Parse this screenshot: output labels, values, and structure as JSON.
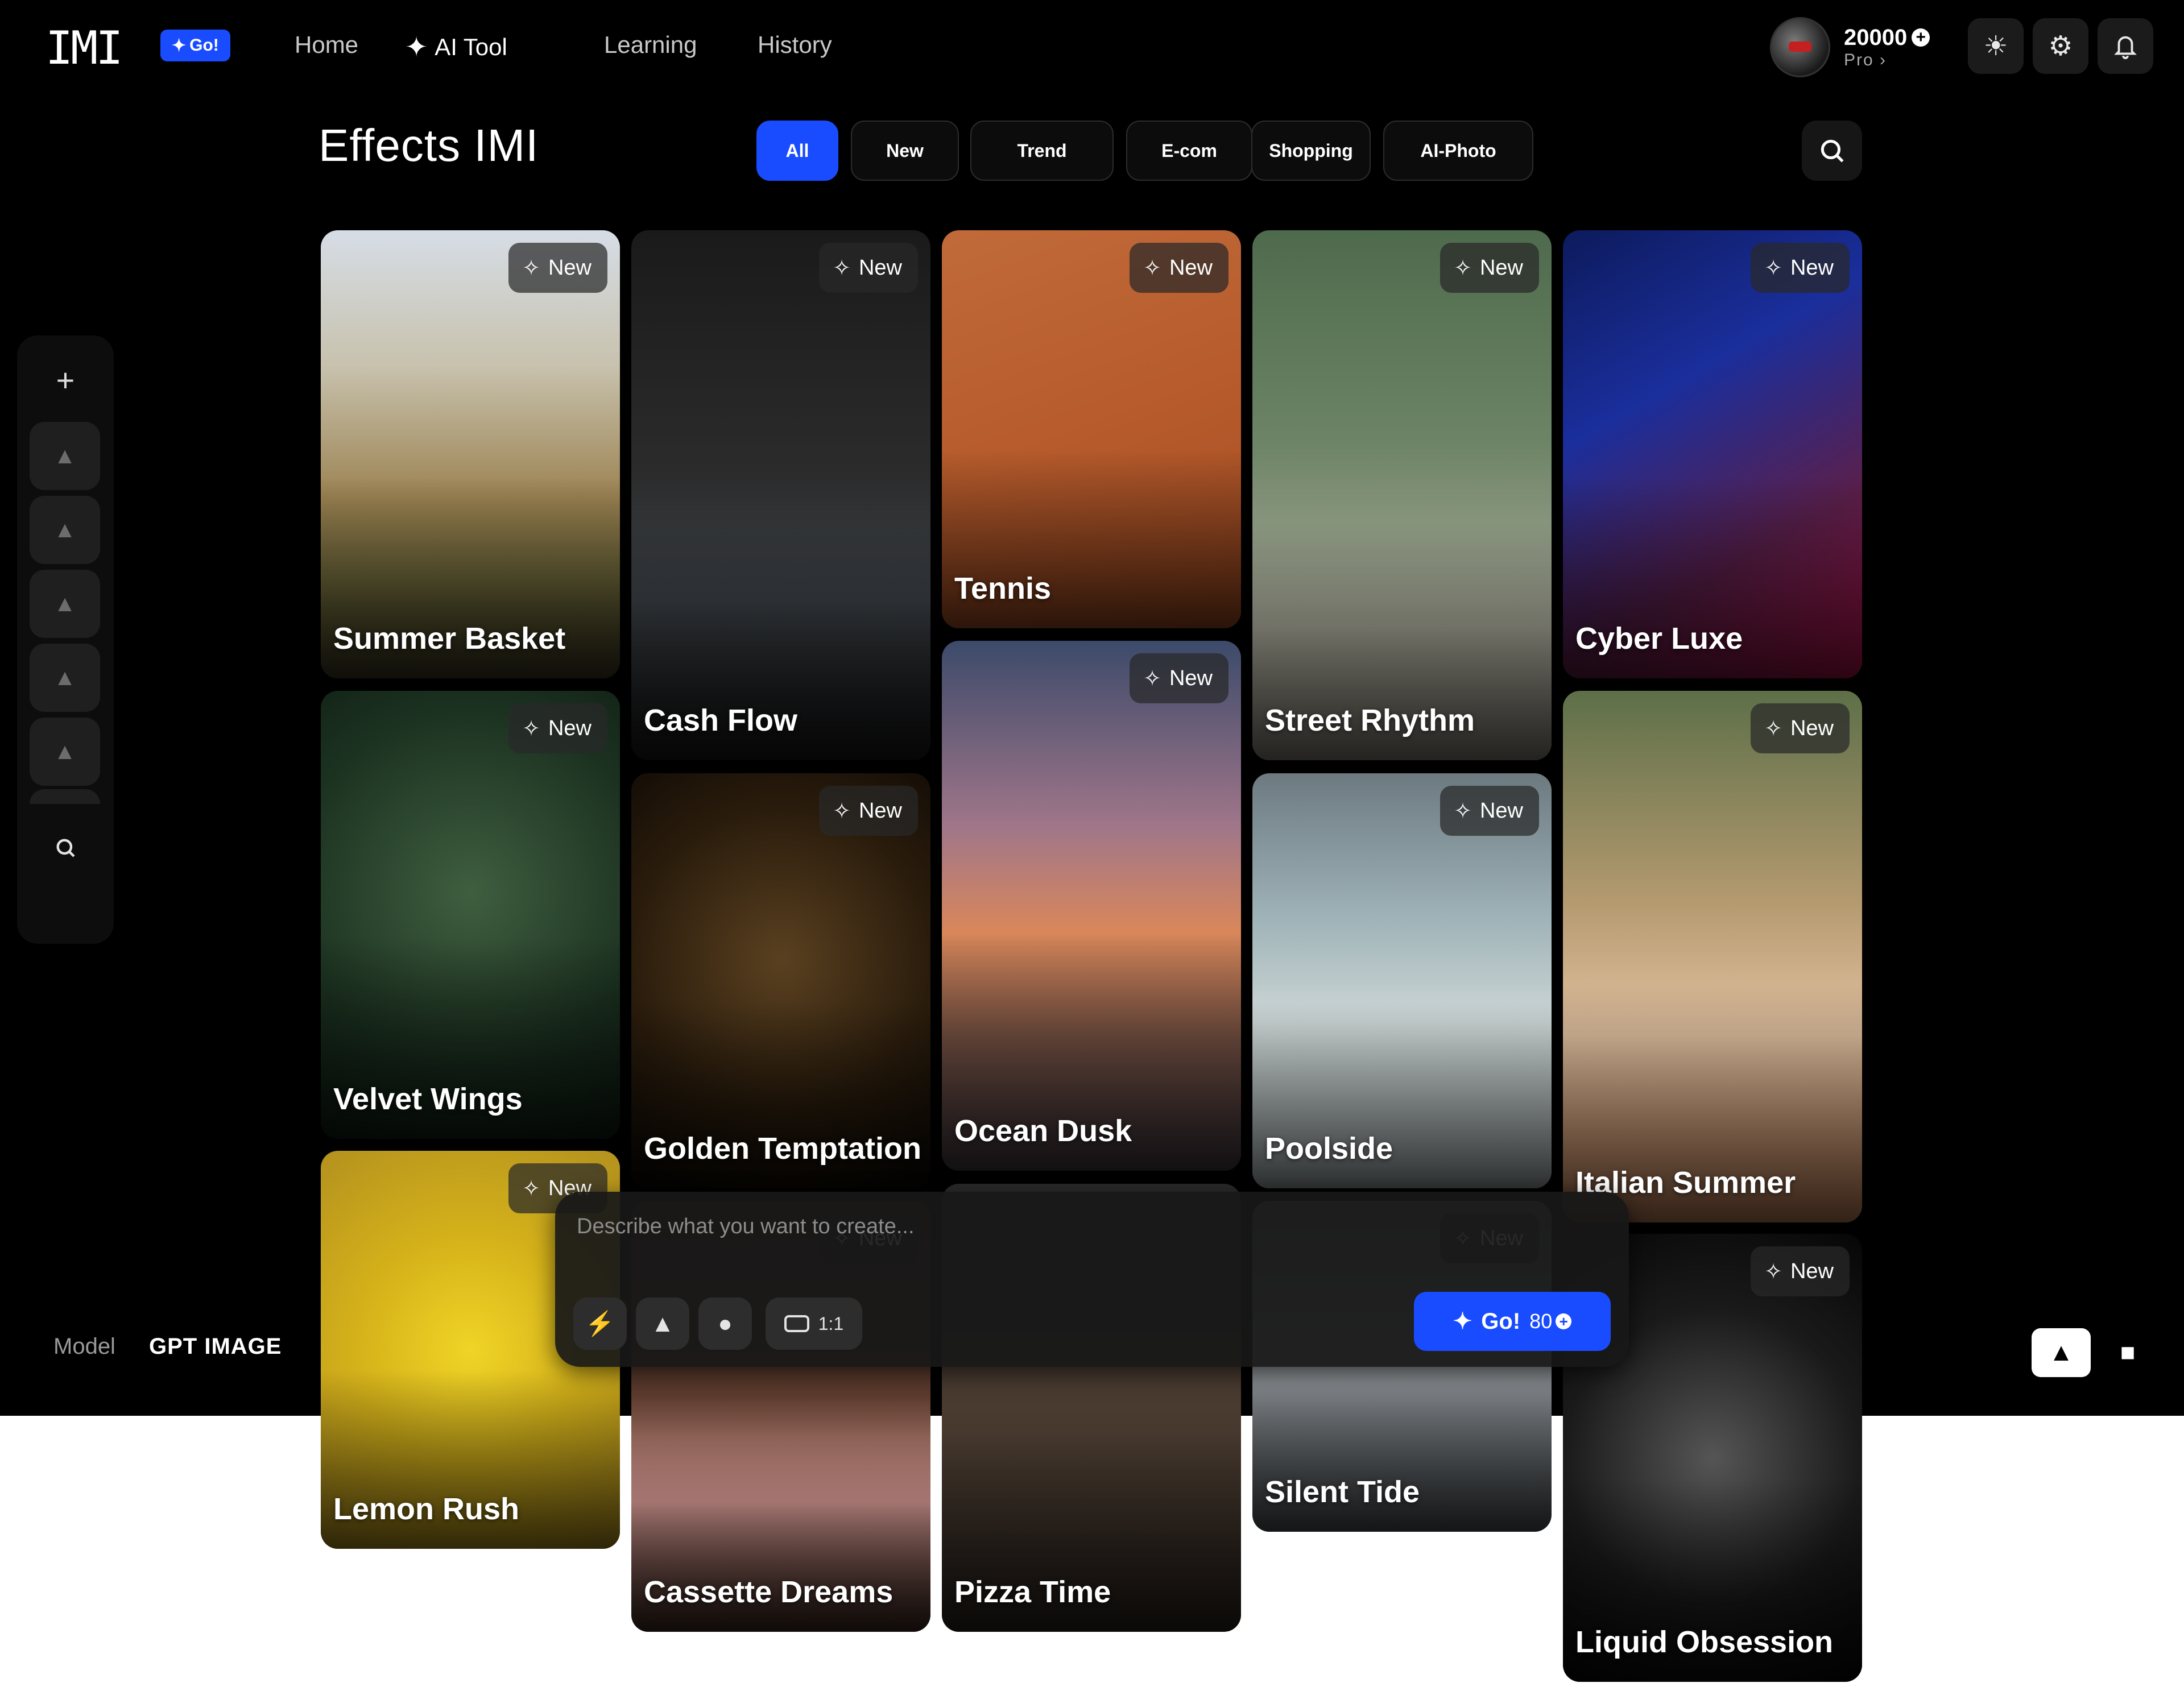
{
  "app": {
    "logo": "IMI",
    "go_badge": "Go!"
  },
  "nav": {
    "home": "Home",
    "ai_tool": "AI Tool",
    "learning": "Learning",
    "history": "History"
  },
  "account": {
    "credits": "20000",
    "tier": "Pro ›"
  },
  "header": {
    "title": "Effects IMI",
    "filters": [
      "All",
      "New",
      "Trend",
      "E-com",
      "Shopping",
      "AI-Photo"
    ],
    "active_filter": "All"
  },
  "model": {
    "label": "Model",
    "value": "GPT IMAGE"
  },
  "cards": [
    {
      "title": "Summer Basket",
      "badge": "New",
      "tone": "a-summer"
    },
    {
      "title": "Cash Flow",
      "badge": "New",
      "tone": "a-cash"
    },
    {
      "title": "Tennis",
      "badge": "New",
      "tone": "a-tennis"
    },
    {
      "title": "Street Rhythm",
      "badge": "New",
      "tone": "a-street"
    },
    {
      "title": "Cyber Luxe",
      "badge": "New",
      "tone": "a-cyber"
    },
    {
      "title": "Velvet Wings",
      "badge": "New",
      "tone": "a-velvet"
    },
    {
      "title": "Golden Temptation",
      "badge": "New",
      "tone": "a-golden"
    },
    {
      "title": "Ocean Dusk",
      "badge": "New",
      "tone": "a-ocean"
    },
    {
      "title": "Poolside",
      "badge": "New",
      "tone": "a-poolside"
    },
    {
      "title": "Italian Summer",
      "badge": "New",
      "tone": "a-italian"
    },
    {
      "title": "Lemon Rush",
      "badge": "New",
      "tone": "a-lemon"
    },
    {
      "title": "Cassette Dreams",
      "badge": "New",
      "tone": "a-cassette"
    },
    {
      "title": "Pizza Time",
      "badge": "",
      "tone": "a-pizza"
    },
    {
      "title": "Silent Tide",
      "badge": "New",
      "tone": "a-silent"
    },
    {
      "title": "Liquid Obsession",
      "badge": "New",
      "tone": "a-liquid"
    }
  ],
  "composer": {
    "placeholder": "Describe what you want to create...",
    "ratio": "1:1",
    "go_label": "Go!",
    "cost": "80"
  },
  "icons": {
    "sparkle": "sparkle-icon",
    "search": "search-icon",
    "sun": "sun-icon",
    "settings": "gear-icon",
    "bell": "bell-icon",
    "image": "image-icon",
    "video": "video-icon"
  },
  "colors": {
    "accent": "#1a4cff",
    "background": "#000000"
  }
}
